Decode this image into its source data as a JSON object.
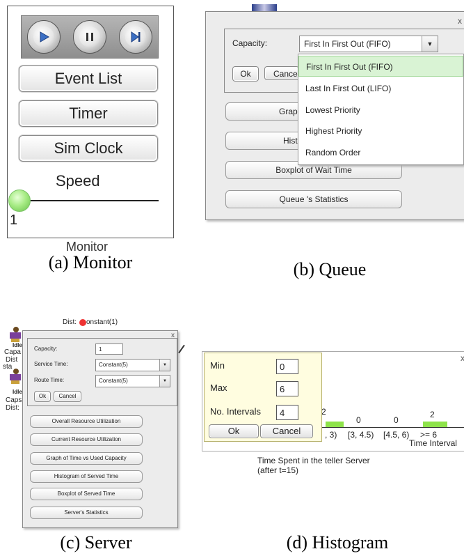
{
  "captions": {
    "a": "(a) Monitor",
    "b": "(b) Queue",
    "c": "(c) Server",
    "d": "(d) Histogram"
  },
  "monitor": {
    "transport": [
      {
        "icon": "play-icon"
      },
      {
        "icon": "pause-icon"
      },
      {
        "icon": "step-forward-icon"
      }
    ],
    "buttons": [
      "Event List",
      "Timer",
      "Sim Clock"
    ],
    "speed_label": "Speed",
    "speed_value": "1",
    "name": "Monitor"
  },
  "queue": {
    "close": "x",
    "capacity_label": "Capacity:",
    "capacity_value": "First In First Out (FIFO)",
    "ok_label": "Ok",
    "cancel_label": "Cance",
    "buttons": [
      "Graph of Qu",
      "Histogra",
      "Boxplot of Wait Time",
      "Queue 's Statistics"
    ],
    "options": [
      "First In First Out (FIFO)",
      "Last In First Out (LIFO)",
      "Lowest Priority",
      "Highest Priority",
      "Random Order"
    ],
    "selected_index": 0
  },
  "server": {
    "bg_text": {
      "dist_top": "Dist:",
      "const_top": "onstant(1)",
      "cap": "Capa",
      "dist": "Dist",
      "sta": "sta",
      "idle1": "Idle",
      "idle2": "Idle",
      "caps": "Caps",
      "dist2": "Dist:"
    },
    "close": "x",
    "fields": {
      "capacity_label": "Capacity:",
      "capacity_value": "1",
      "service_label": "Service Time:",
      "service_value": "Constant(5)",
      "route_label": "Route Time:",
      "route_value": "Constant(5)"
    },
    "ok_label": "Ok",
    "cancel_label": "Cancel",
    "buttons": [
      "Overall Resource Utilization",
      "Current Resource Utilization",
      "Graph of Time vs Used Capacity",
      "Histogram of Served Time",
      "Boxplot of Served Time",
      "Server's Statistics"
    ]
  },
  "histogram": {
    "close": "x",
    "dialog": {
      "min_label": "Min",
      "min_value": "0",
      "max_label": "Max",
      "max_value": "6",
      "intervals_label": "No. Intervals",
      "intervals_value": "4",
      "ok_label": "Ok",
      "cancel_label": "Cancel"
    },
    "bins": [
      "[3, 4.5)",
      "[4.5, 6)",
      ">= 6"
    ],
    "bin_partial": ", 3)",
    "counts": [
      "0",
      "0",
      "2"
    ],
    "count_partial": "2",
    "x_label": "Time Interval",
    "title_line1": "Time Spent in the teller Server",
    "title_line2": "(after t=15)",
    "bar_color": "#8ee34a"
  }
}
